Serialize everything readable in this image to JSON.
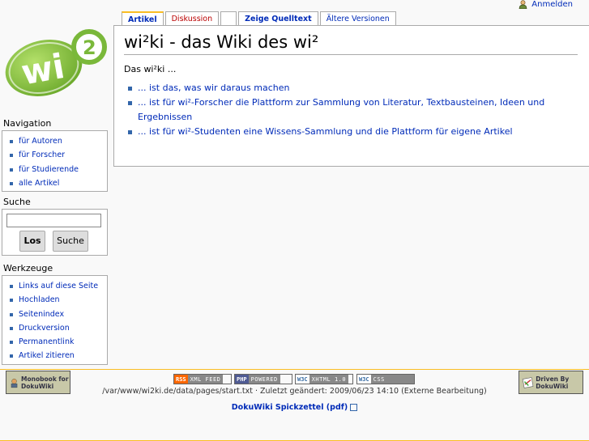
{
  "personal": {
    "login_label": "Anmelden"
  },
  "tabs": [
    {
      "label": "Artikel"
    },
    {
      "label": "Diskussion"
    },
    {
      "label": ""
    },
    {
      "label": "Zeige Quelltext"
    },
    {
      "label": "Ältere Versionen"
    }
  ],
  "logo": {
    "text": "wi",
    "superscript": "2"
  },
  "page": {
    "title": "wi²ki - das Wiki des wi²",
    "intro": "Das wi²ki ...",
    "bullets": [
      "... ist das, was wir daraus machen",
      "... ist für wi²-Forscher die Plattform zur Sammlung von Literatur, Textbausteinen, Ideen und Ergebnissen",
      "... ist für wi²-Studenten eine Wissens-Sammlung und die Plattform für eigene Artikel"
    ]
  },
  "navigation": {
    "title": "Navigation",
    "items": [
      "für Autoren",
      "für Forscher",
      "für Studierende",
      "alle Artikel"
    ]
  },
  "search": {
    "title": "Suche",
    "value": "",
    "go_label": "Los",
    "search_label": "Suche"
  },
  "tools": {
    "title": "Werkzeuge",
    "items": [
      "Links auf diese Seite",
      "Hochladen",
      "Seitenindex",
      "Druckversion",
      "Permanentlink",
      "Artikel zitieren"
    ]
  },
  "footer": {
    "path_text": "/var/www/wi2ki.de/data/pages/start.txt · Zuletzt geändert: 2009/06/23 14:10 (Externe Bearbeitung)",
    "link_label": "DokuWiki Spickzettel (pdf)",
    "badges": [
      {
        "left": "RSS",
        "right": "XML FEED",
        "color": "#ff6600"
      },
      {
        "left": "PHP",
        "right": "POWERED",
        "color": "#4f5b93"
      },
      {
        "left": "W3C",
        "right": "XHTML 1.0",
        "color": "#3a6ea5"
      },
      {
        "left": "W3C",
        "right": "CSS",
        "color": "#3a6ea5"
      }
    ],
    "monobook_label": "Monobook for DokuWiki",
    "driven_label": "Driven By DokuWiki"
  },
  "colors": {
    "accent": "#fabd23",
    "link": "#002bb8",
    "logo_green": "#8dc63f"
  }
}
